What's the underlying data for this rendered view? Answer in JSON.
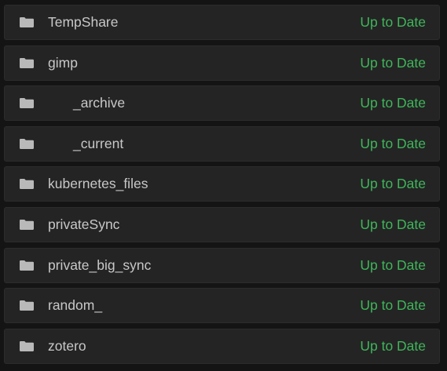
{
  "colors": {
    "status_up_to_date": "#3fb55a",
    "folder_icon": "#b9b9b9"
  },
  "folders": [
    {
      "name": "TempShare",
      "status": "Up to Date",
      "icon": "folder-icon",
      "nested": false
    },
    {
      "name": "gimp",
      "status": "Up to Date",
      "icon": "folder-icon",
      "nested": false
    },
    {
      "name": "_archive",
      "status": "Up to Date",
      "icon": "folder-icon",
      "nested": true
    },
    {
      "name": "_current",
      "status": "Up to Date",
      "icon": "folder-icon",
      "nested": true
    },
    {
      "name": "kubernetes_files",
      "status": "Up to Date",
      "icon": "folder-icon",
      "nested": false
    },
    {
      "name": "privateSync",
      "status": "Up to Date",
      "icon": "folder-icon",
      "nested": false
    },
    {
      "name": "private_big_sync",
      "status": "Up to Date",
      "icon": "folder-icon",
      "nested": false
    },
    {
      "name": "random_",
      "status": "Up to Date",
      "icon": "folder-icon",
      "nested": false
    },
    {
      "name": "zotero",
      "status": "Up to Date",
      "icon": "folder-icon",
      "nested": false
    }
  ]
}
